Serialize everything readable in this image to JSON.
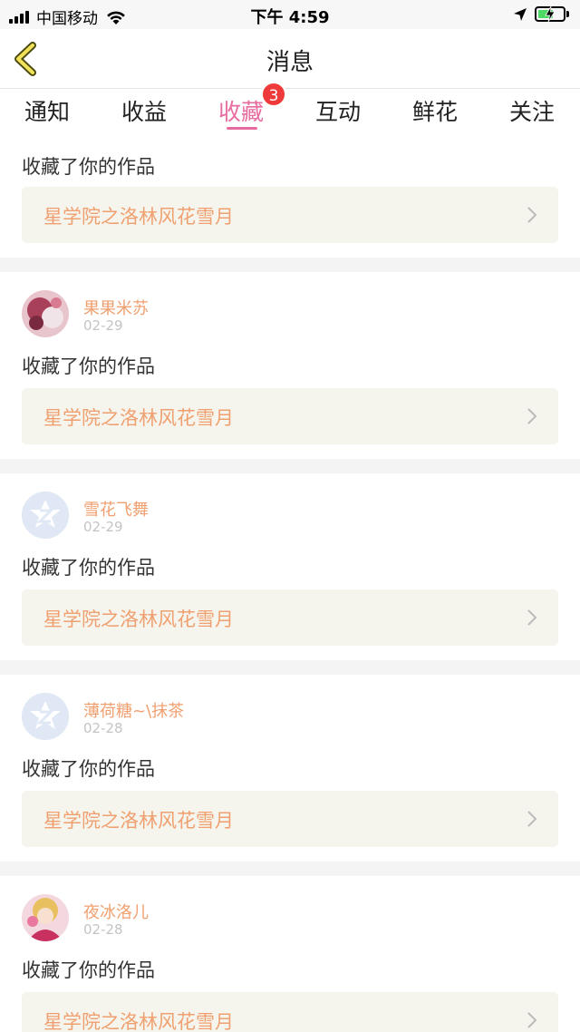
{
  "status_bar": {
    "carrier": "中国移动",
    "time": "下午 4:59"
  },
  "nav": {
    "title": "消息"
  },
  "tabs": [
    {
      "label": "通知"
    },
    {
      "label": "收益"
    },
    {
      "label": "收藏",
      "badge": "3"
    },
    {
      "label": "互动"
    },
    {
      "label": "鲜花"
    },
    {
      "label": "关注"
    }
  ],
  "active_tab": "收藏",
  "colors": {
    "accent": "#e86ba0",
    "badge": "#ee3a3a",
    "highlight_text": "#f0a070",
    "card_bg": "#f5f5ed"
  },
  "feed": {
    "partial_item": {
      "action": "收藏了你的作品",
      "work_title": "星学院之洛林风花雪月"
    },
    "items": [
      {
        "username": "果果米苏",
        "date": "02-29",
        "action": "收藏了你的作品",
        "work_title": "星学院之洛林风花雪月",
        "avatar": "photo-avatar"
      },
      {
        "username": "雪花飞舞",
        "date": "02-29",
        "action": "收藏了你的作品",
        "work_title": "星学院之洛林风花雪月",
        "avatar": "default-avatar"
      },
      {
        "username": "薄荷糖~\\抹茶",
        "date": "02-28",
        "action": "收藏了你的作品",
        "work_title": "星学院之洛林风花雪月",
        "avatar": "default-avatar"
      },
      {
        "username": "夜冰洛儿",
        "date": "02-28",
        "action": "收藏了你的作品",
        "work_title": "星学院之洛林风花雪月",
        "avatar": "photo-avatar"
      }
    ]
  }
}
